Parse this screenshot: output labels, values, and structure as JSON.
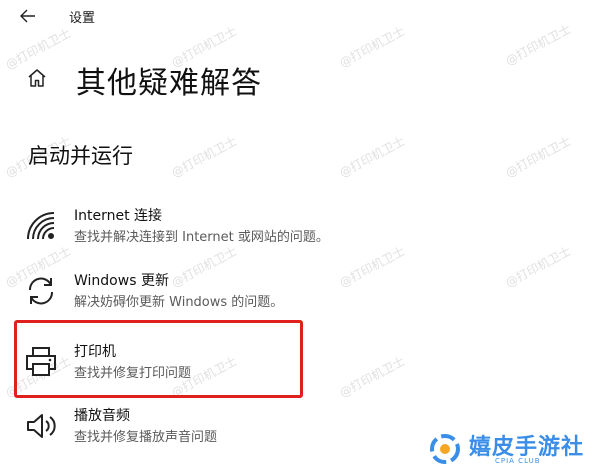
{
  "header": {
    "back_icon": "back-arrow-icon",
    "app_title": "设置"
  },
  "page": {
    "home_icon": "home-icon",
    "title": "其他疑难解答"
  },
  "section": {
    "title": "启动并运行"
  },
  "items": [
    {
      "icon": "wifi-icon",
      "name": "Internet 连接",
      "desc": "查找并解决连接到 Internet 或网站的问题。"
    },
    {
      "icon": "refresh-icon",
      "name": "Windows 更新",
      "desc": "解决妨碍你更新 Windows 的问题。"
    },
    {
      "icon": "printer-icon",
      "name": "打印机",
      "desc": "查找并修复打印问题"
    },
    {
      "icon": "speaker-icon",
      "name": "播放音频",
      "desc": "查找并修复播放声音问题"
    }
  ],
  "highlight_color": "#e0201c",
  "watermark": {
    "text": "@打印机卫士"
  },
  "brand": {
    "name": "嬉皮手游社",
    "sub": "CPIA CLUB",
    "color": "#3a8ee8"
  }
}
